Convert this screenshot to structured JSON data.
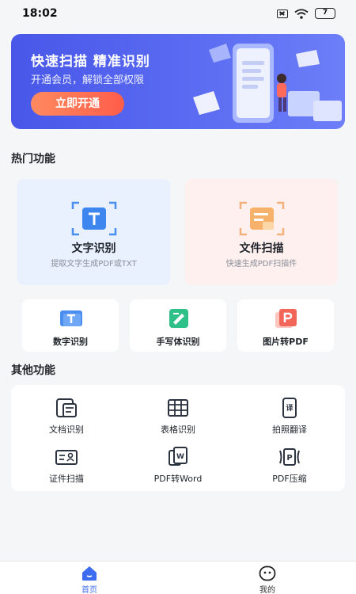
{
  "status_bar": {
    "time": "18:02",
    "battery": "7"
  },
  "banner": {
    "title": "快速扫描  精准识别",
    "subtitle": "开通会员，解锁全部权限",
    "cta": "立即开通"
  },
  "hot": {
    "title": "热门功能",
    "big_cards": [
      {
        "title": "文字识别",
        "subtitle": "提取文字生成PDF或TXT",
        "icon": "text-recognition-icon"
      },
      {
        "title": "文件扫描",
        "subtitle": "快速生成PDF扫描件",
        "icon": "file-scan-icon"
      }
    ],
    "small_cards": [
      {
        "label": "数字识别",
        "icon": "number-recognition-icon"
      },
      {
        "label": "手写体识别",
        "icon": "handwriting-icon"
      },
      {
        "label": "图片转PDF",
        "icon": "image-to-pdf-icon"
      }
    ]
  },
  "other": {
    "title": "其他功能",
    "items": [
      {
        "label": "文档识别",
        "icon": "document-icon"
      },
      {
        "label": "表格识别",
        "icon": "table-icon"
      },
      {
        "label": "拍照翻译",
        "icon": "translate-icon"
      },
      {
        "label": "证件扫描",
        "icon": "id-card-icon"
      },
      {
        "label": "PDF转Word",
        "icon": "pdf-to-word-icon"
      },
      {
        "label": "PDF压缩",
        "icon": "pdf-compress-icon"
      }
    ]
  },
  "tabs": [
    {
      "label": "首页",
      "icon": "home-icon",
      "active": true
    },
    {
      "label": "我的",
      "icon": "profile-icon",
      "active": false
    }
  ],
  "colors": {
    "accent": "#3d6cf0",
    "banner": "#5566ee",
    "cta": "#ff6a4f"
  }
}
